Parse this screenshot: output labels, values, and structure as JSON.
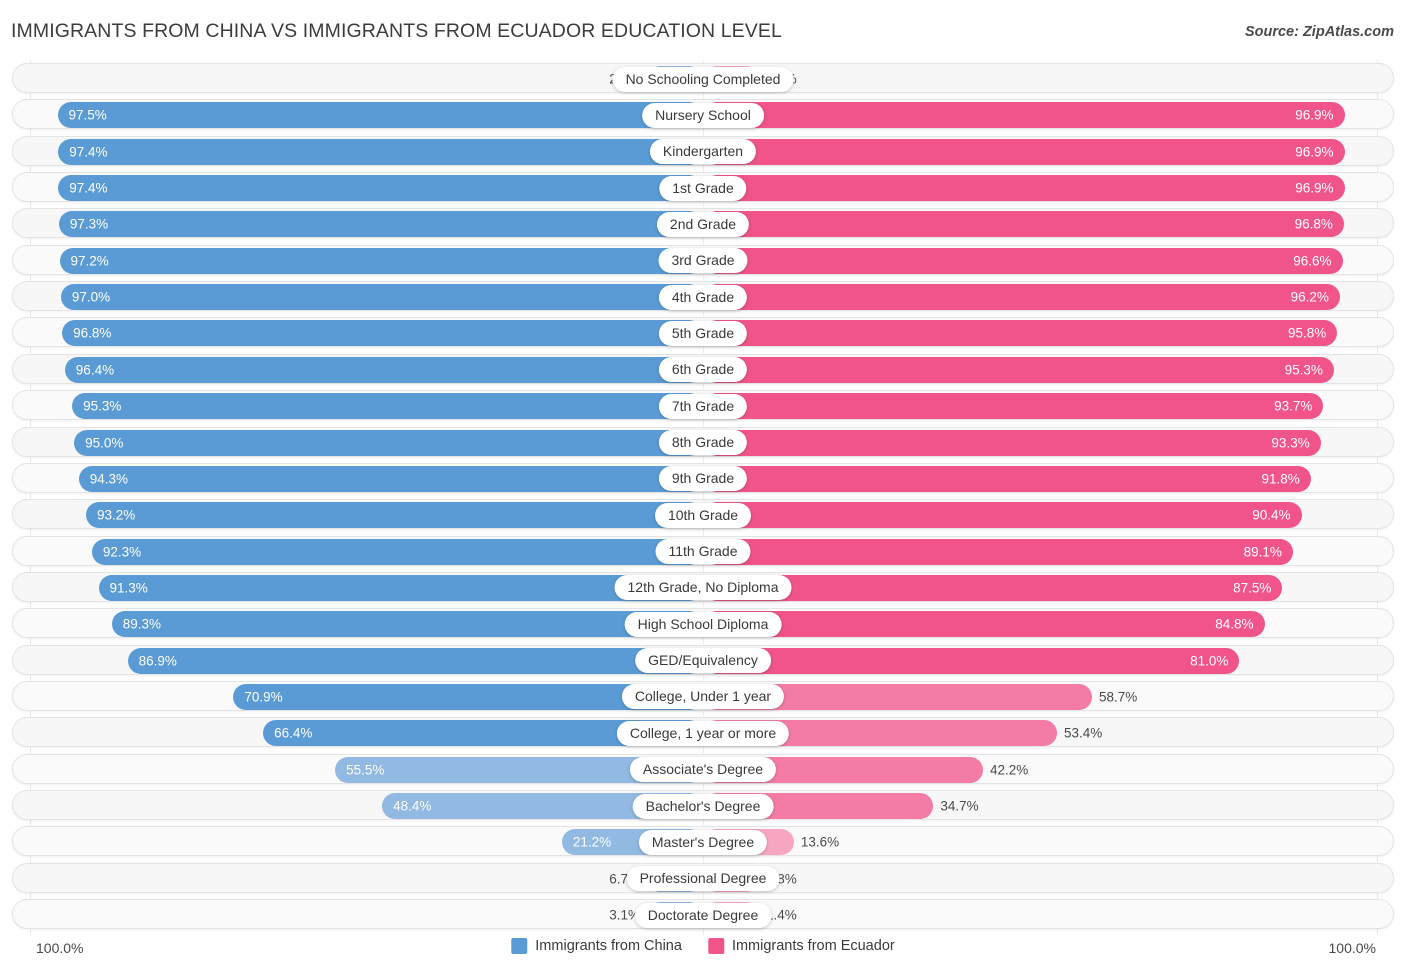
{
  "header": {
    "title": "IMMIGRANTS FROM CHINA VS IMMIGRANTS FROM ECUADOR EDUCATION LEVEL",
    "source": "Source: ZipAtlas.com"
  },
  "footer": {
    "axis_left": "100.0%",
    "axis_right": "100.0%",
    "legend": [
      {
        "label": "Immigrants from China",
        "color": "#5b9bd5"
      },
      {
        "label": "Immigrants from Ecuador",
        "color": "#f0548a"
      }
    ]
  },
  "colors": {
    "blue_strong": "#5b9bd5",
    "blue_light": "#91b9e2",
    "pink_strong": "#f0548a",
    "pink_mid": "#f47ba5",
    "pink_light": "#f7a6c2",
    "row_bg": "#f7f7f7",
    "row_border": "#e4e4e4",
    "gridline": "#e8e8e8"
  },
  "chart_data": {
    "type": "bar",
    "subtype": "diverging-bidirectional",
    "title": "IMMIGRANTS FROM CHINA VS IMMIGRANTS FROM ECUADOR EDUCATION LEVEL",
    "xlabel": "",
    "ylabel": "",
    "xlim": [
      0,
      100
    ],
    "grid": true,
    "legend_position": "bottom-center",
    "axis_max_label": "100.0%",
    "categories": [
      "No Schooling Completed",
      "Nursery School",
      "Kindergarten",
      "1st Grade",
      "2nd Grade",
      "3rd Grade",
      "4th Grade",
      "5th Grade",
      "6th Grade",
      "7th Grade",
      "8th Grade",
      "9th Grade",
      "10th Grade",
      "11th Grade",
      "12th Grade, No Diploma",
      "High School Diploma",
      "GED/Equivalency",
      "College, Under 1 year",
      "College, 1 year or more",
      "Associate's Degree",
      "Bachelor's Degree",
      "Master's Degree",
      "Professional Degree",
      "Doctorate Degree"
    ],
    "series": [
      {
        "name": "Immigrants from China",
        "side": "left",
        "color": "#5b9bd5",
        "values": [
          2.6,
          97.5,
          97.4,
          97.4,
          97.3,
          97.2,
          97.0,
          96.8,
          96.4,
          95.3,
          95.0,
          94.3,
          93.2,
          92.3,
          91.3,
          89.3,
          86.9,
          70.9,
          66.4,
          55.5,
          48.4,
          21.2,
          6.7,
          3.1
        ],
        "labels": [
          "2.6%",
          "97.5%",
          "97.4%",
          "97.4%",
          "97.3%",
          "97.2%",
          "97.0%",
          "96.8%",
          "96.4%",
          "95.3%",
          "95.0%",
          "94.3%",
          "93.2%",
          "92.3%",
          "91.3%",
          "89.3%",
          "86.9%",
          "70.9%",
          "66.4%",
          "55.5%",
          "48.4%",
          "21.2%",
          "6.7%",
          "3.1%"
        ]
      },
      {
        "name": "Immigrants from Ecuador",
        "side": "right",
        "color": "#f0548a",
        "values": [
          3.1,
          96.9,
          96.9,
          96.9,
          96.8,
          96.6,
          96.2,
          95.8,
          95.3,
          93.7,
          93.3,
          91.8,
          90.4,
          89.1,
          87.5,
          84.8,
          81.0,
          58.7,
          53.4,
          42.2,
          34.7,
          13.6,
          3.8,
          1.4
        ],
        "labels": [
          "3.1%",
          "96.9%",
          "96.9%",
          "96.9%",
          "96.8%",
          "96.6%",
          "96.2%",
          "95.8%",
          "95.3%",
          "93.7%",
          "93.3%",
          "91.8%",
          "90.4%",
          "89.1%",
          "87.5%",
          "84.8%",
          "81.0%",
          "58.7%",
          "53.4%",
          "42.2%",
          "34.7%",
          "13.6%",
          "3.8%",
          "1.4%"
        ]
      }
    ]
  }
}
